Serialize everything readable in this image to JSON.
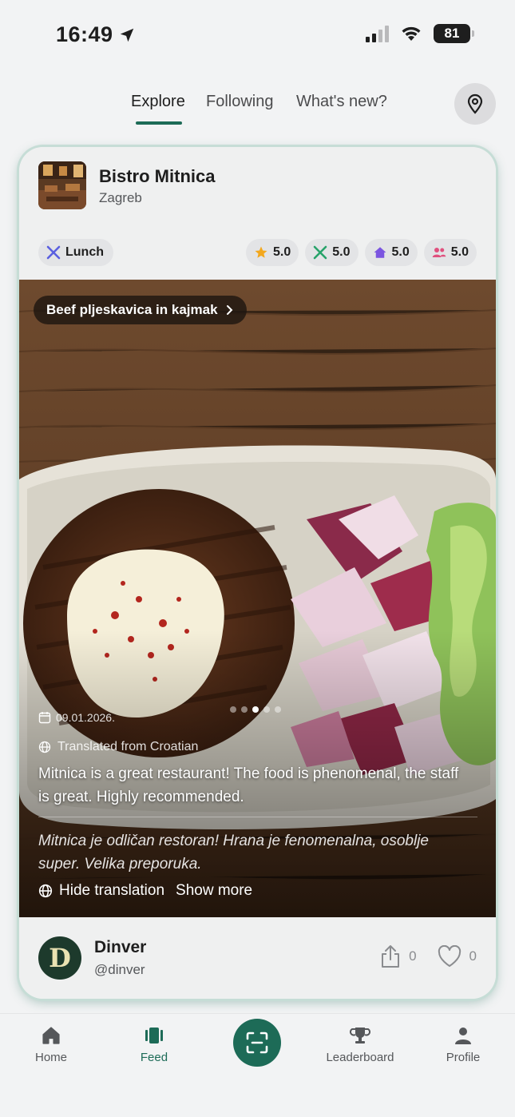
{
  "status_bar": {
    "time": "16:49",
    "battery": "81"
  },
  "tabs": [
    {
      "label": "Explore",
      "active": true
    },
    {
      "label": "Following",
      "active": false
    },
    {
      "label": "What's new?",
      "active": false
    }
  ],
  "post": {
    "restaurant": {
      "name": "Bistro Mitnica",
      "city": "Zagreb"
    },
    "meal_type": "Lunch",
    "ratings": [
      {
        "icon": "star-icon",
        "value": "5.0",
        "color": "#f3a81e"
      },
      {
        "icon": "utensils-icon",
        "value": "5.0",
        "color": "#27a36a"
      },
      {
        "icon": "house-icon",
        "value": "5.0",
        "color": "#7b55e0"
      },
      {
        "icon": "people-icon",
        "value": "5.0",
        "color": "#e0507e"
      }
    ],
    "dish": "Beef pljeskavica in kajmak",
    "date": "09.01.2026.",
    "photo_count": 5,
    "photo_index": 3,
    "translated_label": "Translated from Croatian",
    "review_translated": "Mitnica is a great restaurant! The food is phenomenal, the staff is great. Highly recommended.",
    "review_original": "Mitnica je odličan restoran! Hrana je fenomenalna, osoblje super. Velika preporuka.",
    "hide_translation": "Hide translation",
    "show_more": "Show more",
    "author": {
      "initial": "D",
      "name": "Dinver",
      "handle": "@dinver"
    },
    "shares": "0",
    "likes": "0"
  },
  "bottom_nav": {
    "home": "Home",
    "feed": "Feed",
    "leaderboard": "Leaderboard",
    "profile": "Profile"
  },
  "colors": {
    "accent": "#1d6b57",
    "meal_icon": "#5a5fe0"
  }
}
